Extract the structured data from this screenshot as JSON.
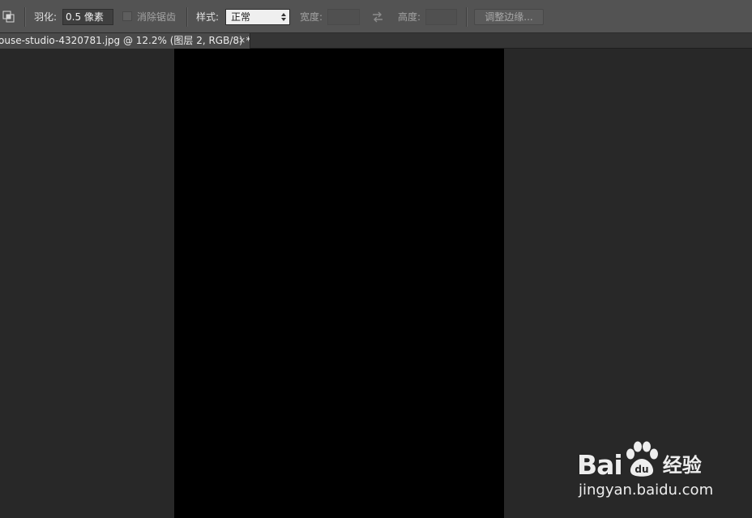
{
  "options_bar": {
    "tool_icon": "intersect-selection-icon",
    "feather_label": "羽化:",
    "feather_value": "0.5 像素",
    "antialias_label": "消除锯齿",
    "antialias_checked": false,
    "style_label": "样式:",
    "style_value": "正常",
    "width_label": "宽度:",
    "width_value": "",
    "swap_icon": "swap-arrows-icon",
    "height_label": "高度:",
    "height_value": "",
    "refine_edge_label": "调整边缘..."
  },
  "document_tab": {
    "title": "ouse-studio-4320781.jpg @ 12.2% (图层 2, RGB/8) *",
    "close_label": "×"
  },
  "canvas": {
    "fill_color": "#000000"
  },
  "watermark": {
    "logo_prefix": "Bai",
    "logo_suffix": "du",
    "logo_cn": "经验",
    "url": "jingyan.baidu.com"
  },
  "colors": {
    "options_bar_bg": "#535353",
    "pasteboard_bg": "#282828",
    "tab_bg": "#4a4a4a"
  }
}
